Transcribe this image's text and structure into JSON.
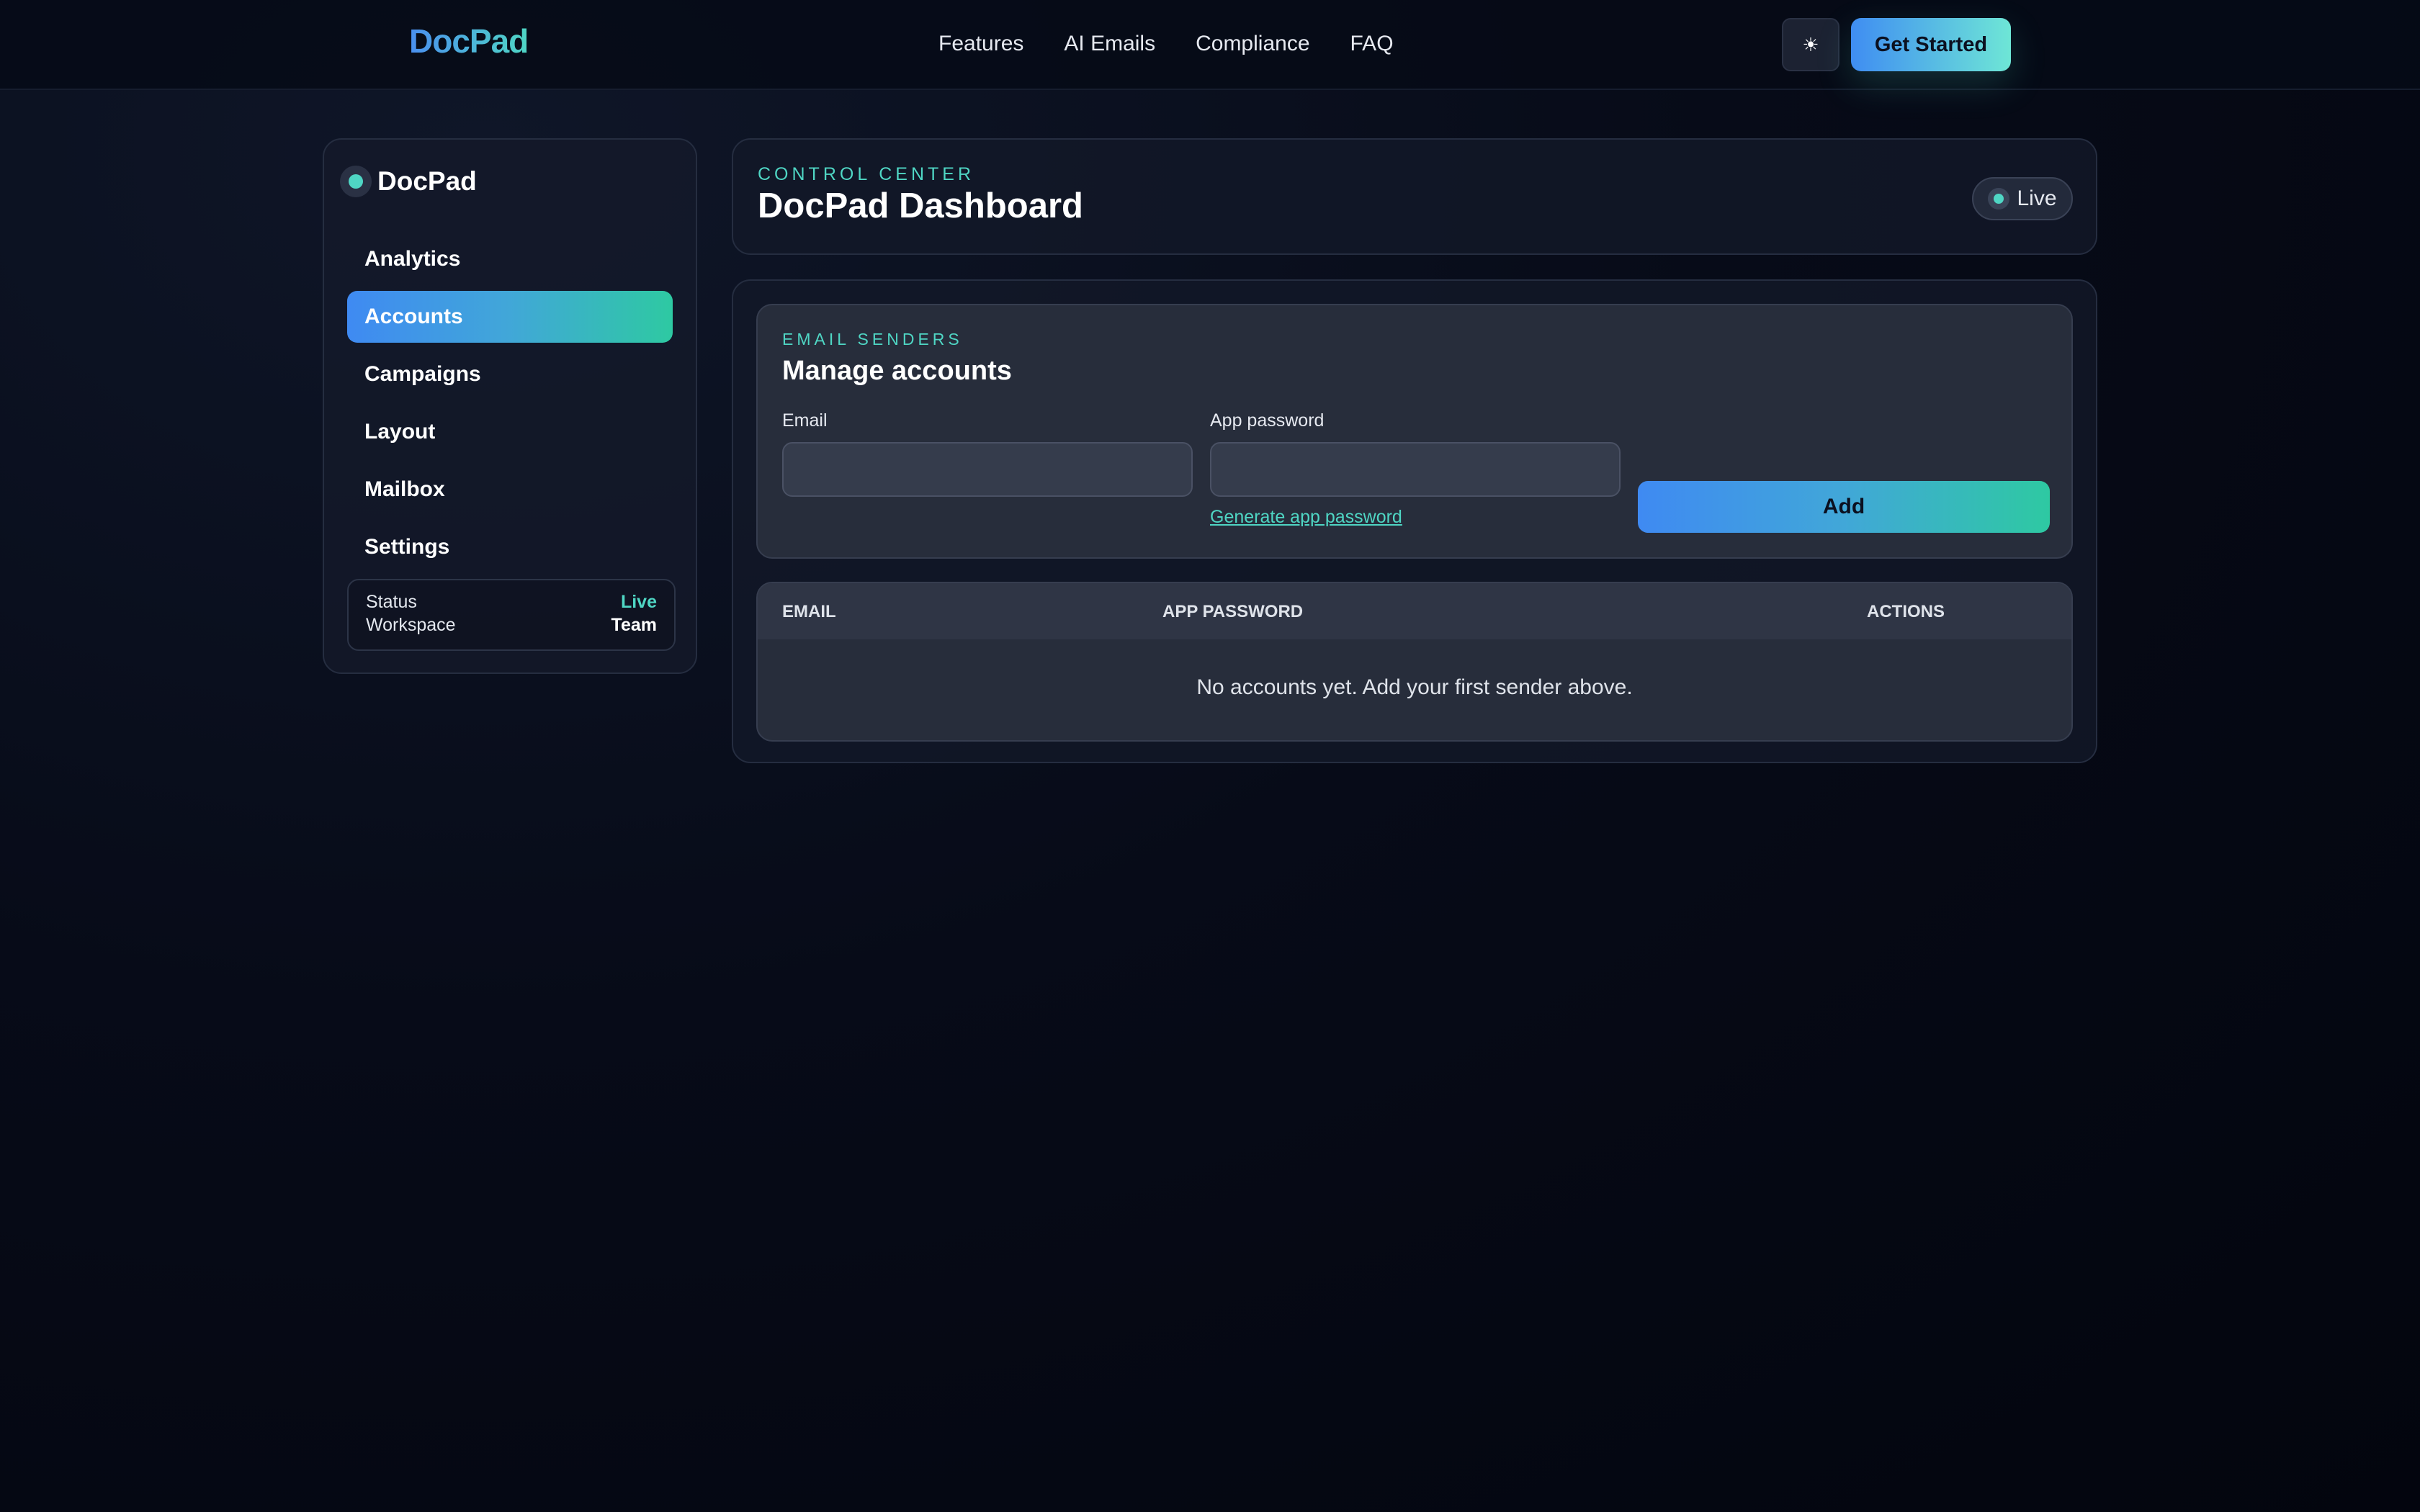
{
  "topnav": {
    "brand": "DocPad",
    "links": [
      "Features",
      "AI Emails",
      "Compliance",
      "FAQ"
    ],
    "theme_icon": "sun-icon",
    "theme_glyph": "☀",
    "cta_label": "Get Started"
  },
  "sidebar": {
    "title": "DocPad",
    "items": [
      {
        "label": "Analytics",
        "active": false
      },
      {
        "label": "Accounts",
        "active": true
      },
      {
        "label": "Campaigns",
        "active": false
      },
      {
        "label": "Layout",
        "active": false
      },
      {
        "label": "Mailbox",
        "active": false
      },
      {
        "label": "Settings",
        "active": false
      }
    ],
    "status": {
      "status_label": "Status",
      "status_value": "Live",
      "workspace_label": "Workspace",
      "workspace_value": "Team"
    }
  },
  "header": {
    "kicker": "CONTROL CENTER",
    "title": "DocPad Dashboard",
    "live_label": "Live"
  },
  "accounts_form": {
    "kicker": "EMAIL SENDERS",
    "title": "Manage accounts",
    "email_label": "Email",
    "email_value": "",
    "email_placeholder": "",
    "password_label": "App password",
    "password_value": "",
    "password_placeholder": "",
    "generate_link": "Generate app password",
    "add_label": "Add"
  },
  "accounts_table": {
    "columns": [
      "EMAIL",
      "APP PASSWORD",
      "ACTIONS"
    ],
    "rows": [],
    "empty_message": "No accounts yet. Add your first sender above."
  },
  "colors": {
    "accent_teal": "#4fd6c4",
    "accent_blue": "#3f8af2",
    "background": "#070b18"
  }
}
